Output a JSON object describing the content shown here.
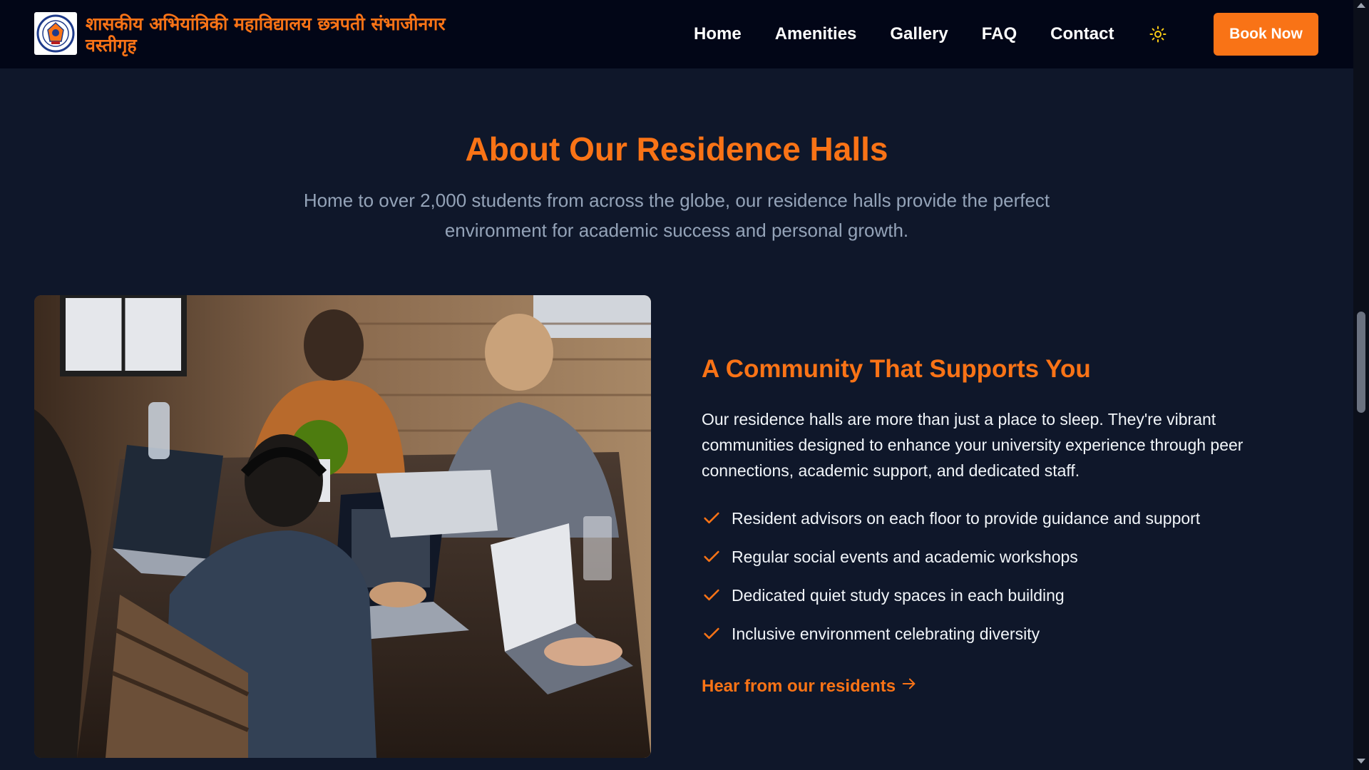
{
  "header": {
    "brand_text": "शासकीय अभियांत्रिकी महाविद्यालय छत्रपती संभाजीनगर वस्तीगृह",
    "nav": [
      {
        "label": "Home"
      },
      {
        "label": "Amenities"
      },
      {
        "label": "Gallery"
      },
      {
        "label": "FAQ"
      },
      {
        "label": "Contact"
      }
    ],
    "theme_icon": "sun-icon",
    "book_label": "Book Now"
  },
  "about": {
    "title": "About Our Residence Halls",
    "subtitle": "Home to over 2,000 students from across the globe, our residence halls provide the perfect environment for academic success and personal growth."
  },
  "community": {
    "title": "A Community That Supports You",
    "description": "Our residence halls are more than just a place to sleep. They're vibrant communities designed to enhance your university experience through peer connections, academic support, and dedicated staff.",
    "features": [
      {
        "text": "Resident advisors on each floor to provide guidance and support"
      },
      {
        "text": "Regular social events and academic workshops"
      },
      {
        "text": "Dedicated quiet study spaces in each building"
      },
      {
        "text": "Inclusive environment celebrating diversity"
      }
    ],
    "link_label": "Hear from our residents",
    "link_icon": "arrow-right-icon"
  },
  "colors": {
    "accent": "#f97316",
    "background": "#0f172a",
    "header_bg": "#020617"
  }
}
